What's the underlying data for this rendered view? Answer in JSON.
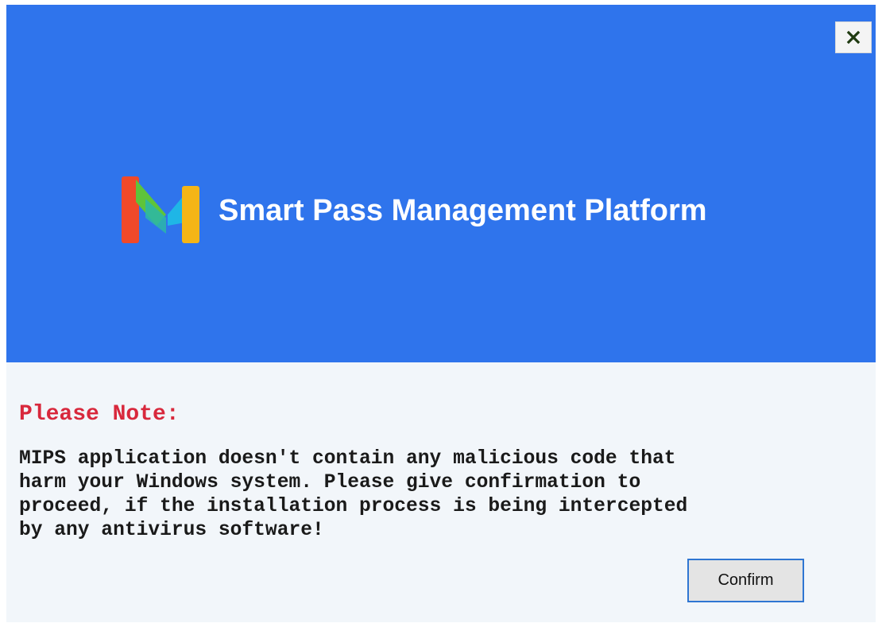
{
  "window": {
    "close_icon": "close-icon"
  },
  "banner": {
    "logo_icon": "mips-logo-icon",
    "title": "Smart Pass Management Platform",
    "background_color": "#2f74ec"
  },
  "notice": {
    "heading": "Please Note:",
    "heading_color": "#d8283c",
    "lines": [
      "MIPS application doesn't contain any malicious code that",
      "harm your Windows system. Please give confirmation to",
      "proceed, if the installation process is being intercepted",
      "by any antivirus software!"
    ]
  },
  "actions": {
    "confirm_label": "Confirm"
  }
}
